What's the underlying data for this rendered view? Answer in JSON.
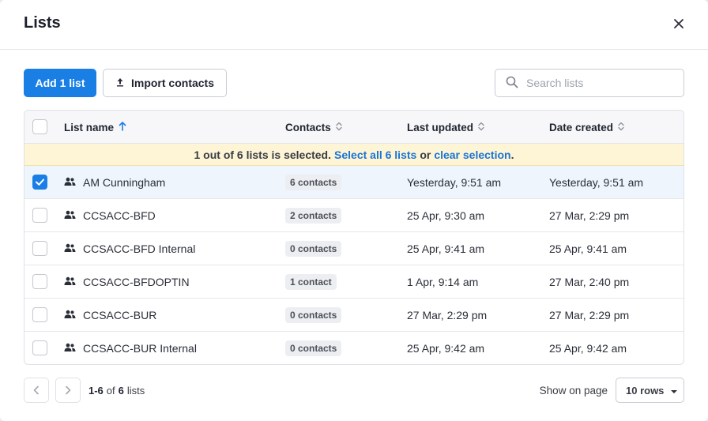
{
  "modal": {
    "title": "Lists"
  },
  "toolbar": {
    "add_label": "Add 1 list",
    "import_label": "Import contacts",
    "search_placeholder": "Search lists"
  },
  "table": {
    "columns": [
      "List name",
      "Contacts",
      "Last updated",
      "Date created"
    ],
    "banner": {
      "text": "1 out of 6 lists is selected.",
      "select_all": "Select all 6 lists",
      "or": "or",
      "clear": "clear selection",
      "end": "."
    },
    "rows": [
      {
        "name": "AM Cunningham",
        "contacts": "6 contacts",
        "updated": "Yesterday, 9:51 am",
        "created": "Yesterday, 9:51 am",
        "selected": true
      },
      {
        "name": "CCSACC-BFD",
        "contacts": "2 contacts",
        "updated": "25 Apr, 9:30 am",
        "created": "27 Mar, 2:29 pm",
        "selected": false
      },
      {
        "name": "CCSACC-BFD Internal",
        "contacts": "0 contacts",
        "updated": "25 Apr, 9:41 am",
        "created": "25 Apr, 9:41 am",
        "selected": false
      },
      {
        "name": "CCSACC-BFDOPTIN",
        "contacts": "1 contact",
        "updated": "1 Apr, 9:14 am",
        "created": "27 Mar, 2:40 pm",
        "selected": false
      },
      {
        "name": "CCSACC-BUR",
        "contacts": "0 contacts",
        "updated": "27 Mar, 2:29 pm",
        "created": "27 Mar, 2:29 pm",
        "selected": false
      },
      {
        "name": "CCSACC-BUR Internal",
        "contacts": "0 contacts",
        "updated": "25 Apr, 9:42 am",
        "created": "25 Apr, 9:42 am",
        "selected": false
      }
    ]
  },
  "footer": {
    "range": "1-6",
    "of": "of",
    "total": "6",
    "unit": "lists",
    "show_label": "Show on page",
    "rows_value": "10 rows"
  },
  "colors": {
    "accent": "#1a7fe5",
    "banner": "#fdf5d5",
    "selected_row": "#eef5fd"
  }
}
